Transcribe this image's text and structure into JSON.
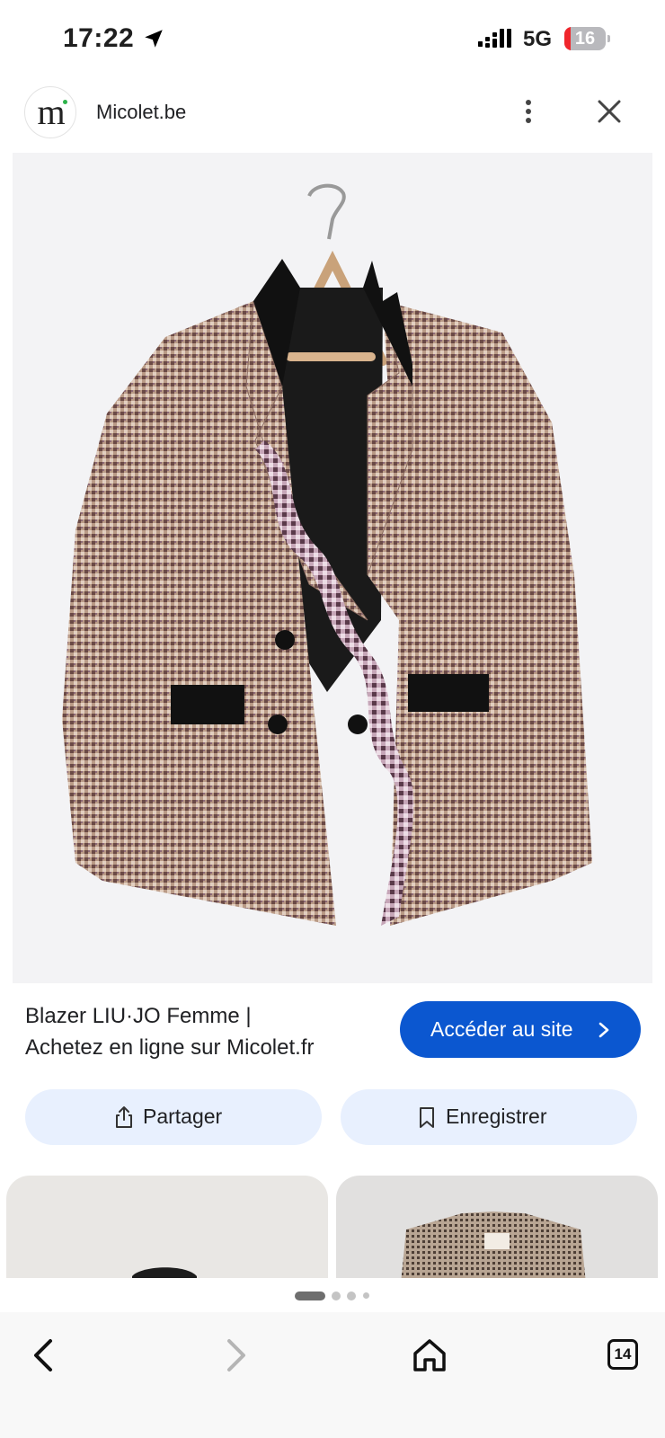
{
  "status_bar": {
    "time": "17:22",
    "network": "5G",
    "battery_level": "16",
    "battery_fraction": 0.16,
    "icons": [
      "location-arrow-icon",
      "signal-bars-icon",
      "battery-icon"
    ]
  },
  "header": {
    "logo_letter": "m",
    "site_name": "Micolet.be",
    "icons": [
      "more-vertical-icon",
      "close-icon"
    ]
  },
  "result": {
    "title_line1": "Blazer LIU·JO Femme |",
    "title_line2": "Achetez en ligne sur Micolet.fr",
    "visit_button": "Accéder au site"
  },
  "actions": {
    "share_label": "Partager",
    "save_label": "Enregistrer"
  },
  "pagination": {
    "pages": 4,
    "current": 1
  },
  "bottom_nav": {
    "tabs_count": "14",
    "icons": [
      "back-arrow-icon",
      "forward-arrow-icon",
      "home-icon",
      "tabs-icon"
    ]
  },
  "colors": {
    "accent": "#0b57d0",
    "chip_background": "#e8f0fe",
    "battery_low": "#f0262c",
    "image_background": "#f3f3f5"
  }
}
